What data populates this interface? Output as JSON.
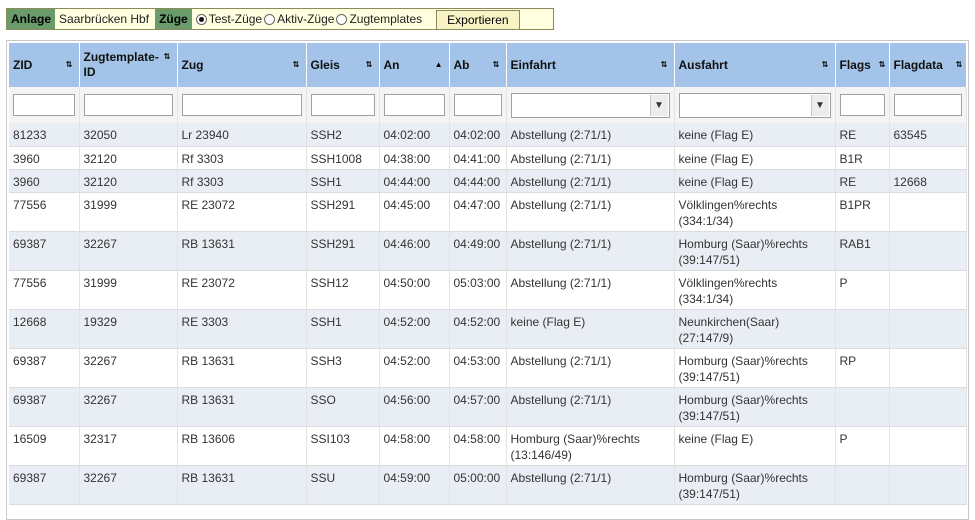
{
  "toolbar": {
    "anlage_label": "Anlage",
    "anlage_value": "Saarbrücken Hbf",
    "zuege_label": "Züge",
    "radio_options": [
      {
        "label": "Test-Züge",
        "selected": true
      },
      {
        "label": "Aktiv-Züge",
        "selected": false
      },
      {
        "label": "Zugtemplates",
        "selected": false
      }
    ],
    "export_label": "Exportieren"
  },
  "table": {
    "columns": [
      "ZID",
      "Zugtemplate-ID",
      "Zug",
      "Gleis",
      "An",
      "Ab",
      "Einfahrt",
      "Ausfahrt",
      "Flags",
      "Flagdata"
    ],
    "sort_icons": [
      "⇅",
      "⇅",
      "⇅",
      "⇅",
      "▲",
      "⇅",
      "⇅",
      "⇅",
      "⇅",
      "⇅"
    ],
    "rows": [
      {
        "zid": "81233",
        "tpl": "32050",
        "zug": "Lr 23940",
        "gleis": "SSH2",
        "an": "04:02:00",
        "ab": "04:02:00",
        "einfahrt": "Abstellung (2:71/1)",
        "ausfahrt": "keine (Flag E)",
        "flags": "RE",
        "flagdata": "63545"
      },
      {
        "zid": "3960",
        "tpl": "32120",
        "zug": "Rf 3303",
        "gleis": "SSH1008",
        "an": "04:38:00",
        "ab": "04:41:00",
        "einfahrt": "Abstellung (2:71/1)",
        "ausfahrt": "keine (Flag E)",
        "flags": "B1R",
        "flagdata": ""
      },
      {
        "zid": "3960",
        "tpl": "32120",
        "zug": "Rf 3303",
        "gleis": "SSH1",
        "an": "04:44:00",
        "ab": "04:44:00",
        "einfahrt": "Abstellung (2:71/1)",
        "ausfahrt": "keine (Flag E)",
        "flags": "RE",
        "flagdata": "12668"
      },
      {
        "zid": "77556",
        "tpl": "31999",
        "zug": "RE 23072",
        "gleis": "SSH291",
        "an": "04:45:00",
        "ab": "04:47:00",
        "einfahrt": "Abstellung (2:71/1)",
        "ausfahrt": "Völklingen%rechts\n(334:1/34)",
        "flags": "B1PR",
        "flagdata": ""
      },
      {
        "zid": "69387",
        "tpl": "32267",
        "zug": "RB 13631",
        "gleis": "SSH291",
        "an": "04:46:00",
        "ab": "04:49:00",
        "einfahrt": "Abstellung (2:71/1)",
        "ausfahrt": "Homburg (Saar)%rechts\n(39:147/51)",
        "flags": "RAB1",
        "flagdata": ""
      },
      {
        "zid": "77556",
        "tpl": "31999",
        "zug": "RE 23072",
        "gleis": "SSH12",
        "an": "04:50:00",
        "ab": "05:03:00",
        "einfahrt": "Abstellung (2:71/1)",
        "ausfahrt": "Völklingen%rechts\n(334:1/34)",
        "flags": "P",
        "flagdata": ""
      },
      {
        "zid": "12668",
        "tpl": "19329",
        "zug": "RE 3303",
        "gleis": "SSH1",
        "an": "04:52:00",
        "ab": "04:52:00",
        "einfahrt": "keine (Flag E)",
        "ausfahrt": "Neunkirchen(Saar)\n(27:147/9)",
        "flags": "",
        "flagdata": ""
      },
      {
        "zid": "69387",
        "tpl": "32267",
        "zug": "RB 13631",
        "gleis": "SSH3",
        "an": "04:52:00",
        "ab": "04:53:00",
        "einfahrt": "Abstellung (2:71/1)",
        "ausfahrt": "Homburg (Saar)%rechts\n(39:147/51)",
        "flags": "RP",
        "flagdata": ""
      },
      {
        "zid": "69387",
        "tpl": "32267",
        "zug": "RB 13631",
        "gleis": "SSO",
        "an": "04:56:00",
        "ab": "04:57:00",
        "einfahrt": "Abstellung (2:71/1)",
        "ausfahrt": "Homburg (Saar)%rechts\n(39:147/51)",
        "flags": "",
        "flagdata": ""
      },
      {
        "zid": "16509",
        "tpl": "32317",
        "zug": "RB 13606",
        "gleis": "SSI103",
        "an": "04:58:00",
        "ab": "04:58:00",
        "einfahrt": "Homburg (Saar)%rechts\n(13:146/49)",
        "ausfahrt": "keine (Flag E)",
        "flags": "P",
        "flagdata": ""
      },
      {
        "zid": "69387",
        "tpl": "32267",
        "zug": "RB 13631",
        "gleis": "SSU",
        "an": "04:59:00",
        "ab": "05:00:00",
        "einfahrt": "Abstellung (2:71/1)",
        "ausfahrt": "Homburg (Saar)%rechts\n(39:147/51)",
        "flags": "",
        "flagdata": ""
      }
    ]
  }
}
